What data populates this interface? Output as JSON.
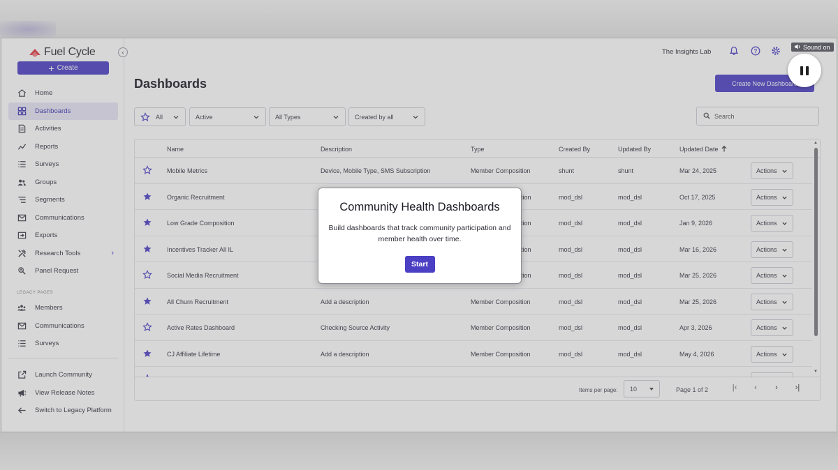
{
  "brand": {
    "name": "Fuel Cycle"
  },
  "sidebar": {
    "create_label": "Create",
    "items": [
      {
        "label": "Home",
        "icon": "home-icon"
      },
      {
        "label": "Dashboards",
        "icon": "dashboards-icon",
        "active": true
      },
      {
        "label": "Activities",
        "icon": "activities-icon"
      },
      {
        "label": "Reports",
        "icon": "reports-icon"
      },
      {
        "label": "Surveys",
        "icon": "surveys-icon"
      },
      {
        "label": "Groups",
        "icon": "groups-icon"
      },
      {
        "label": "Segments",
        "icon": "segments-icon"
      },
      {
        "label": "Communications",
        "icon": "mail-icon"
      },
      {
        "label": "Exports",
        "icon": "exports-icon"
      },
      {
        "label": "Research Tools",
        "icon": "tools-icon"
      },
      {
        "label": "Panel Request",
        "icon": "panel-request-icon"
      }
    ],
    "legacy_label": "LEGACY PAGES",
    "legacy_items": [
      {
        "label": "Members",
        "icon": "members-icon"
      },
      {
        "label": "Communications",
        "icon": "mail-icon"
      },
      {
        "label": "Surveys",
        "icon": "surveys-icon"
      }
    ],
    "bottom_items": [
      {
        "label": "Launch Community",
        "icon": "external-link-icon"
      },
      {
        "label": "View Release Notes",
        "icon": "megaphone-icon"
      },
      {
        "label": "Switch to Legacy Platform",
        "icon": "arrow-left-icon"
      }
    ]
  },
  "topbar": {
    "org_name": "The Insights Lab",
    "sound_label": "Sound on"
  },
  "page": {
    "title": "Dashboards",
    "new_button": "Create New Dashboard",
    "filters": {
      "favorites": "All",
      "status": "Active",
      "type": "All Types",
      "created_by": "Created by all"
    },
    "search_placeholder": "Search"
  },
  "table": {
    "columns": [
      "Name",
      "Description",
      "Type",
      "Created By",
      "Updated By",
      "Updated Date"
    ],
    "actions_label": "Actions",
    "rows": [
      {
        "starred": false,
        "name": "Mobile Metrics",
        "description": "Device, Mobile Type, SMS Subscription",
        "type": "Member Composition",
        "created_by": "shunt",
        "updated_by": "shunt",
        "updated": "Mar 24, 2025"
      },
      {
        "starred": true,
        "name": "Organic Recruitment",
        "description": "",
        "type": "ition",
        "created_by": "mod_dsl",
        "updated_by": "mod_dsl",
        "updated": "Oct 17, 2025"
      },
      {
        "starred": true,
        "name": "Low Grade Composition",
        "description": "",
        "type": "ition",
        "created_by": "mod_dsl",
        "updated_by": "mod_dsl",
        "updated": "Jan 9, 2026"
      },
      {
        "starred": true,
        "name": "Incentives Tracker All IL",
        "description": "",
        "type": "ition",
        "created_by": "mod_dsl",
        "updated_by": "mod_dsl",
        "updated": "Mar 16, 2026"
      },
      {
        "starred": false,
        "name": "Social Media Recruitment",
        "description": "",
        "type": "ition",
        "created_by": "mod_dsl",
        "updated_by": "mod_dsl",
        "updated": "Mar 25, 2026"
      },
      {
        "starred": true,
        "name": "All Churn Recruitment",
        "description": "Add a description",
        "type": "Member Composition",
        "created_by": "mod_dsl",
        "updated_by": "mod_dsl",
        "updated": "Mar 25, 2026"
      },
      {
        "starred": false,
        "name": "Active Rates Dashboard",
        "description": "Checking Source Activity",
        "type": "Member Composition",
        "created_by": "mod_dsl",
        "updated_by": "mod_dsl",
        "updated": "Apr 3, 2026"
      },
      {
        "starred": true,
        "name": "CJ Affiliate Lifetime",
        "description": "Add a description",
        "type": "Member Composition",
        "created_by": "mod_dsl",
        "updated_by": "mod_dsl",
        "updated": "May 4, 2026"
      }
    ]
  },
  "pagination": {
    "items_per_page_label": "Items per page:",
    "items_per_page": "10",
    "page_label": "Page 1 of 2"
  },
  "modal": {
    "title": "Community Health Dashboards",
    "body": "Build dashboards that track community participation and member health over time.",
    "button": "Start"
  },
  "colors": {
    "accent": "#4b3fc4"
  }
}
